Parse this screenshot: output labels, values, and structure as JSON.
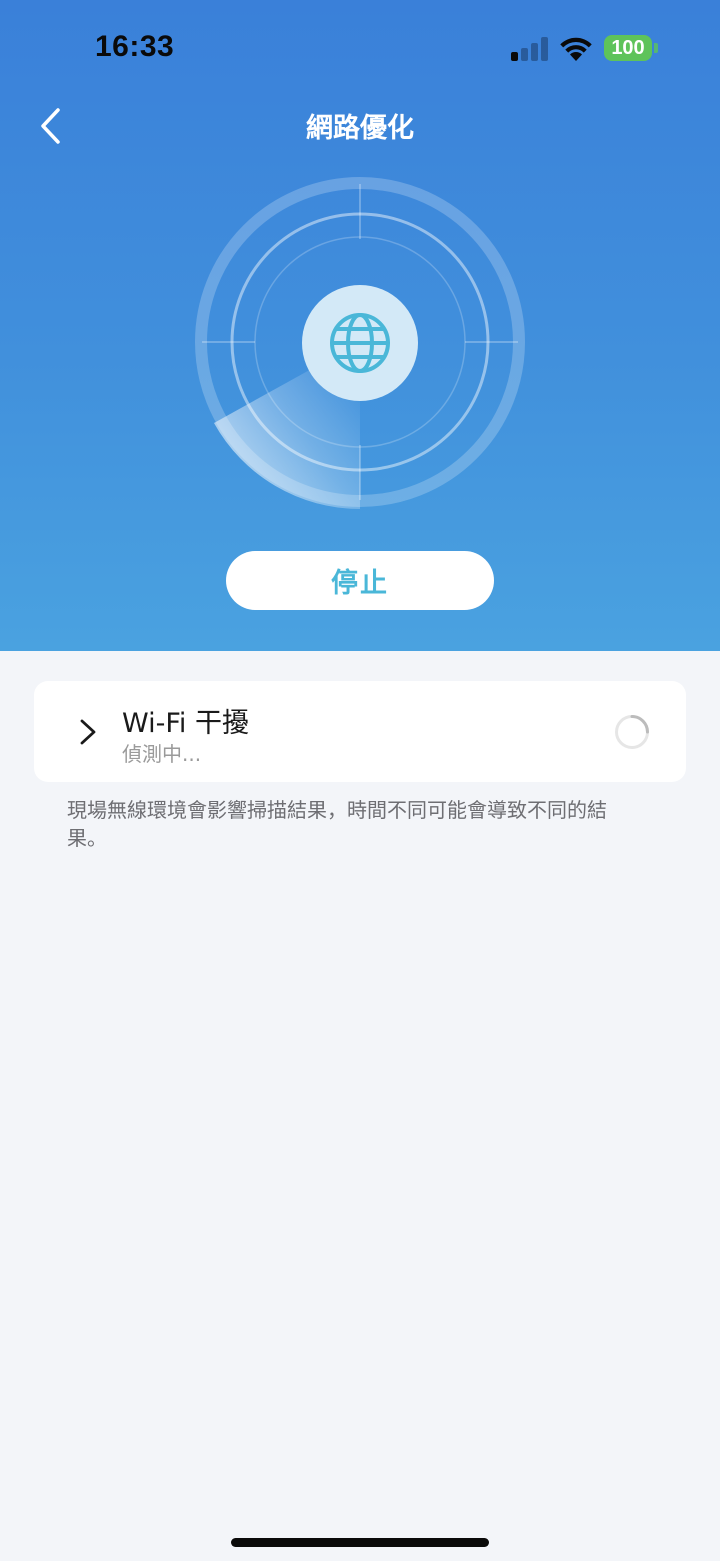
{
  "status_bar": {
    "time": "16:33",
    "battery": "100",
    "signal_bars_active": 1,
    "signal_bars_total": 4
  },
  "header": {
    "title": "網路優化",
    "back_icon": "chevron-left-icon"
  },
  "radar": {
    "center_icon": "globe-icon"
  },
  "actions": {
    "stop_label": "停止"
  },
  "scan_item": {
    "title": "Wi-Fi 干擾",
    "status": "偵測中...",
    "expand_icon": "chevron-right-icon",
    "progress_icon": "spinner-icon"
  },
  "note": "現場無線環境會影響掃描結果，時間不同可能會導致不同的結果。",
  "colors": {
    "header_top": "#3a80d9",
    "header_bottom": "#4aa2e0",
    "accent": "#4ab7d8",
    "battery": "#5ec35a",
    "background": "#f3f5f9"
  }
}
